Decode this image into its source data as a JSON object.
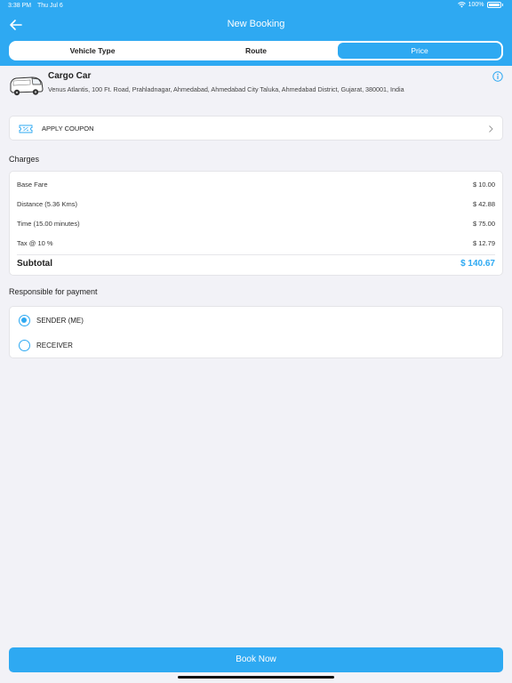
{
  "status_bar": {
    "time": "3:38 PM",
    "date": "Thu Jul 6",
    "battery": "100%"
  },
  "header": {
    "title": "New Booking"
  },
  "tabs": [
    {
      "label": "Vehicle Type",
      "active": false
    },
    {
      "label": "Route",
      "active": false
    },
    {
      "label": "Price",
      "active": true
    }
  ],
  "vehicle": {
    "name": "Cargo Car",
    "address": "Venus Atlantis, 100 Ft. Road, Prahladnagar, Ahmedabad, Ahmedabad City Taluka, Ahmedabad District, Gujarat, 380001, India"
  },
  "coupon": {
    "label": "APPLY COUPON"
  },
  "charges": {
    "title": "Charges",
    "items": [
      {
        "label": "Base Fare",
        "value": "$ 10.00"
      },
      {
        "label": "Distance (5.36 Kms)",
        "value": "$ 42.88"
      },
      {
        "label": "Time (15.00 minutes)",
        "value": "$ 75.00"
      },
      {
        "label": "Tax @ 10 %",
        "value": "$ 12.79"
      }
    ],
    "subtotal_label": "Subtotal",
    "subtotal_value": "$ 140.67"
  },
  "payment": {
    "title": "Responsible for payment",
    "options": [
      {
        "label": "SENDER (ME)",
        "selected": true
      },
      {
        "label": "RECEIVER",
        "selected": false
      }
    ]
  },
  "book_button": {
    "label": "Book Now"
  },
  "colors": {
    "accent": "#2ea9f2",
    "background": "#f2f2f7"
  }
}
